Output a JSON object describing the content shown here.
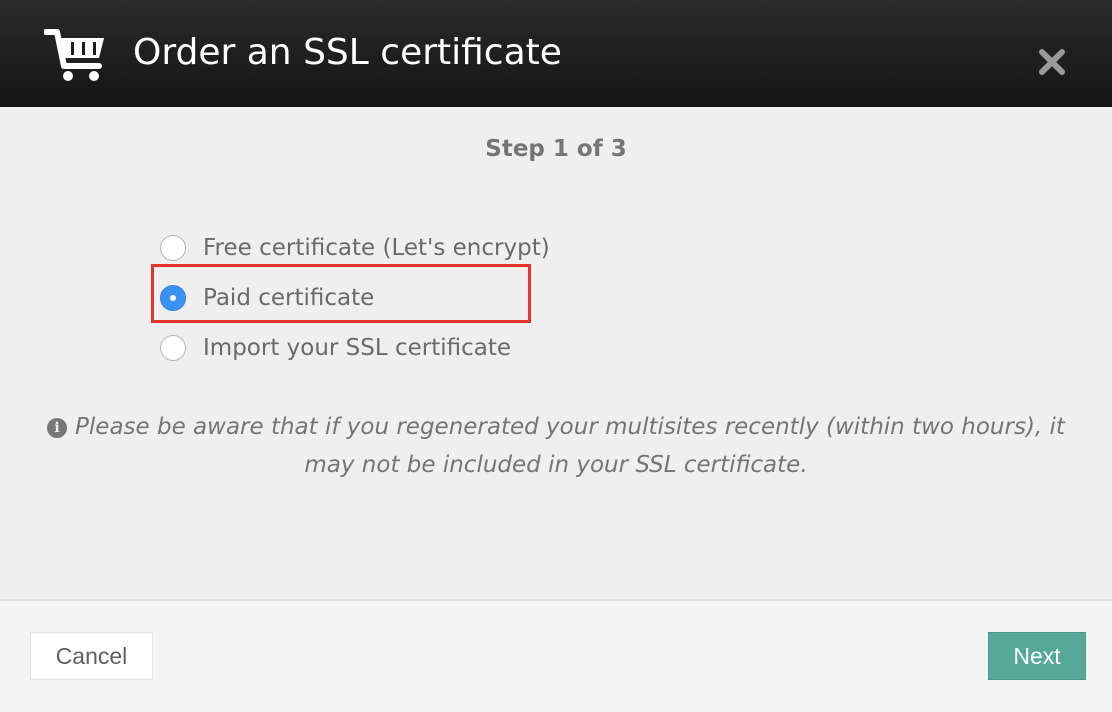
{
  "dialog": {
    "title": "Order an SSL certificate",
    "title_icon": "shopping-cart-icon",
    "close_icon": "close-icon"
  },
  "step": {
    "label": "Step 1 of 3",
    "current": 1,
    "total": 3
  },
  "options": [
    {
      "label": "Free certificate (Let's encrypt)",
      "selected": false
    },
    {
      "label": "Paid certificate",
      "selected": true
    },
    {
      "label": "Import your SSL certificate",
      "selected": false
    }
  ],
  "notice": {
    "icon": "info-icon",
    "text": "Please be aware that if you regenerated your multisites recently (within two hours), it may not be included in your SSL certificate."
  },
  "footer": {
    "cancel_label": "Cancel",
    "next_label": "Next"
  },
  "colors": {
    "header": "#1c1c1c",
    "radio_selected": "#3b92f0",
    "highlight_border": "#e8332b",
    "next_button": "#55a998"
  }
}
